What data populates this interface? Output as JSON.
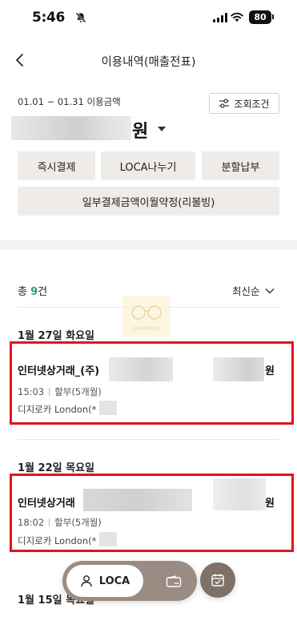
{
  "status_bar": {
    "time": "5:46",
    "battery": "80"
  },
  "header": {
    "title": "이용내역(매출전표)"
  },
  "summary": {
    "period": "01.01 ~ 01.31 이용금액",
    "amount_unit": "원",
    "filter_label": "조회조건"
  },
  "actions": {
    "instant_pay": "즉시결제",
    "loca_split": "LOCA나누기",
    "installment": "분할납부",
    "revolving": "일부결제금액이월약정(리볼빙)"
  },
  "list": {
    "total_prefix": "총 ",
    "total_count": "9",
    "total_suffix": "건",
    "sort_label": "최신순",
    "groups": [
      {
        "date": "1월 27일 화요일",
        "merchant": "인터넷상거래_(주)",
        "amount_suffix": "원",
        "time": "15:03",
        "installment": "할부(5개월)",
        "card": "디지로카 London(*"
      },
      {
        "date": "1월 22일 목요일",
        "merchant": "인터넷상거래",
        "amount_suffix": "원",
        "time": "18:02",
        "installment": "할부(5개월)",
        "card": "디지로카 London(*"
      },
      {
        "date": "1월 15일 목요일"
      }
    ]
  },
  "watermark": {
    "text": "SmartMLab"
  },
  "tabbar": {
    "loca_label": "LOCA"
  },
  "colors": {
    "accent_green": "#2c9a74",
    "highlight_red": "#e0141e",
    "tabbar_bg": "#9a8c82"
  }
}
